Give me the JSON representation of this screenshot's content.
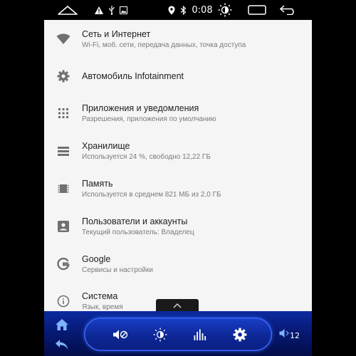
{
  "status_bar": {
    "time": "0:08",
    "icons": [
      "home-icon",
      "warning-icon",
      "usb-icon",
      "image-icon",
      "location-icon",
      "bluetooth-icon",
      "brightness-icon",
      "recents-icon",
      "back-icon"
    ]
  },
  "settings": {
    "items": [
      {
        "title": "Сеть и Интернет",
        "subtitle": "Wi-Fi, моб. сети, передача данных, точка доступа",
        "icon": "wifi-icon"
      },
      {
        "title": "Автомобиль Infotainment",
        "subtitle": "",
        "icon": "gear-icon"
      },
      {
        "title": "Приложения и уведомления",
        "subtitle": "Разрешения, приложения по умолчанию",
        "icon": "apps-grid-icon"
      },
      {
        "title": "Хранилище",
        "subtitle": "Используется 24 %, свободно 12,22 ГБ",
        "icon": "storage-icon"
      },
      {
        "title": "Память",
        "subtitle": "Используется в среднем 821 МБ из 2,0 ГБ",
        "icon": "memory-icon"
      },
      {
        "title": "Пользователи и аккаунты",
        "subtitle": "Текущий пользователь: Владелец",
        "icon": "account-icon"
      },
      {
        "title": "Google",
        "subtitle": "Сервисы и настройки",
        "icon": "google-icon"
      },
      {
        "title": "Система",
        "subtitle": "Язык, время",
        "icon": "info-icon"
      }
    ]
  },
  "bottom_bar": {
    "volume_level": "12",
    "icons": [
      "home-icon",
      "back-icon",
      "mute-icon",
      "brightness-icon",
      "equalizer-icon",
      "settings-gear-icon",
      "volume-icon"
    ]
  },
  "colors": {
    "bar_blue": "#0b2aa0",
    "accent_blue": "#3a66ff",
    "list_bg": "#f5f5f5",
    "icon_gray": "#707070"
  }
}
